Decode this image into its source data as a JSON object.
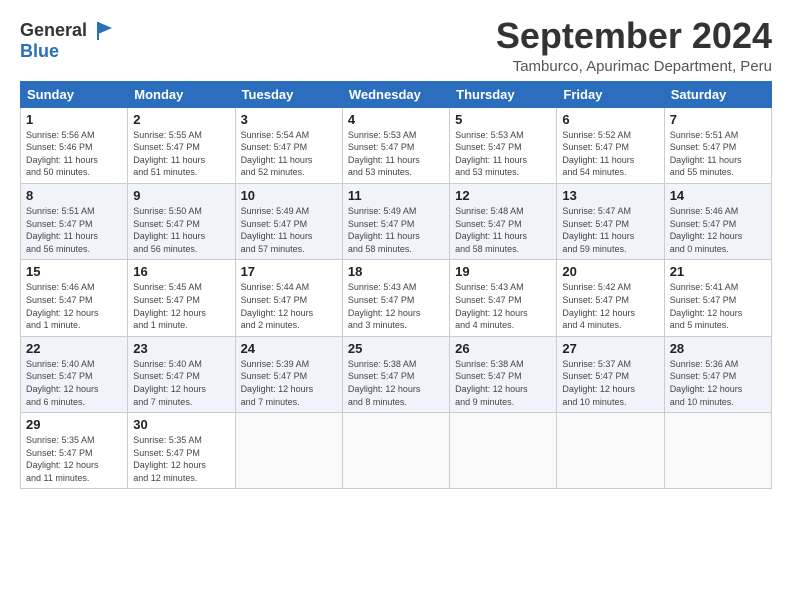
{
  "header": {
    "logo": {
      "line1": "General",
      "line2": "Blue"
    },
    "title": "September 2024",
    "subtitle": "Tamburco, Apurimac Department, Peru"
  },
  "weekdays": [
    "Sunday",
    "Monday",
    "Tuesday",
    "Wednesday",
    "Thursday",
    "Friday",
    "Saturday"
  ],
  "weeks": [
    [
      {
        "day": "1",
        "info": "Sunrise: 5:56 AM\nSunset: 5:46 PM\nDaylight: 11 hours\nand 50 minutes."
      },
      {
        "day": "2",
        "info": "Sunrise: 5:55 AM\nSunset: 5:47 PM\nDaylight: 11 hours\nand 51 minutes."
      },
      {
        "day": "3",
        "info": "Sunrise: 5:54 AM\nSunset: 5:47 PM\nDaylight: 11 hours\nand 52 minutes."
      },
      {
        "day": "4",
        "info": "Sunrise: 5:53 AM\nSunset: 5:47 PM\nDaylight: 11 hours\nand 53 minutes."
      },
      {
        "day": "5",
        "info": "Sunrise: 5:53 AM\nSunset: 5:47 PM\nDaylight: 11 hours\nand 53 minutes."
      },
      {
        "day": "6",
        "info": "Sunrise: 5:52 AM\nSunset: 5:47 PM\nDaylight: 11 hours\nand 54 minutes."
      },
      {
        "day": "7",
        "info": "Sunrise: 5:51 AM\nSunset: 5:47 PM\nDaylight: 11 hours\nand 55 minutes."
      }
    ],
    [
      {
        "day": "8",
        "info": "Sunrise: 5:51 AM\nSunset: 5:47 PM\nDaylight: 11 hours\nand 56 minutes."
      },
      {
        "day": "9",
        "info": "Sunrise: 5:50 AM\nSunset: 5:47 PM\nDaylight: 11 hours\nand 56 minutes."
      },
      {
        "day": "10",
        "info": "Sunrise: 5:49 AM\nSunset: 5:47 PM\nDaylight: 11 hours\nand 57 minutes."
      },
      {
        "day": "11",
        "info": "Sunrise: 5:49 AM\nSunset: 5:47 PM\nDaylight: 11 hours\nand 58 minutes."
      },
      {
        "day": "12",
        "info": "Sunrise: 5:48 AM\nSunset: 5:47 PM\nDaylight: 11 hours\nand 58 minutes."
      },
      {
        "day": "13",
        "info": "Sunrise: 5:47 AM\nSunset: 5:47 PM\nDaylight: 11 hours\nand 59 minutes."
      },
      {
        "day": "14",
        "info": "Sunrise: 5:46 AM\nSunset: 5:47 PM\nDaylight: 12 hours\nand 0 minutes."
      }
    ],
    [
      {
        "day": "15",
        "info": "Sunrise: 5:46 AM\nSunset: 5:47 PM\nDaylight: 12 hours\nand 1 minute."
      },
      {
        "day": "16",
        "info": "Sunrise: 5:45 AM\nSunset: 5:47 PM\nDaylight: 12 hours\nand 1 minute."
      },
      {
        "day": "17",
        "info": "Sunrise: 5:44 AM\nSunset: 5:47 PM\nDaylight: 12 hours\nand 2 minutes."
      },
      {
        "day": "18",
        "info": "Sunrise: 5:43 AM\nSunset: 5:47 PM\nDaylight: 12 hours\nand 3 minutes."
      },
      {
        "day": "19",
        "info": "Sunrise: 5:43 AM\nSunset: 5:47 PM\nDaylight: 12 hours\nand 4 minutes."
      },
      {
        "day": "20",
        "info": "Sunrise: 5:42 AM\nSunset: 5:47 PM\nDaylight: 12 hours\nand 4 minutes."
      },
      {
        "day": "21",
        "info": "Sunrise: 5:41 AM\nSunset: 5:47 PM\nDaylight: 12 hours\nand 5 minutes."
      }
    ],
    [
      {
        "day": "22",
        "info": "Sunrise: 5:40 AM\nSunset: 5:47 PM\nDaylight: 12 hours\nand 6 minutes."
      },
      {
        "day": "23",
        "info": "Sunrise: 5:40 AM\nSunset: 5:47 PM\nDaylight: 12 hours\nand 7 minutes."
      },
      {
        "day": "24",
        "info": "Sunrise: 5:39 AM\nSunset: 5:47 PM\nDaylight: 12 hours\nand 7 minutes."
      },
      {
        "day": "25",
        "info": "Sunrise: 5:38 AM\nSunset: 5:47 PM\nDaylight: 12 hours\nand 8 minutes."
      },
      {
        "day": "26",
        "info": "Sunrise: 5:38 AM\nSunset: 5:47 PM\nDaylight: 12 hours\nand 9 minutes."
      },
      {
        "day": "27",
        "info": "Sunrise: 5:37 AM\nSunset: 5:47 PM\nDaylight: 12 hours\nand 10 minutes."
      },
      {
        "day": "28",
        "info": "Sunrise: 5:36 AM\nSunset: 5:47 PM\nDaylight: 12 hours\nand 10 minutes."
      }
    ],
    [
      {
        "day": "29",
        "info": "Sunrise: 5:35 AM\nSunset: 5:47 PM\nDaylight: 12 hours\nand 11 minutes."
      },
      {
        "day": "30",
        "info": "Sunrise: 5:35 AM\nSunset: 5:47 PM\nDaylight: 12 hours\nand 12 minutes."
      },
      {
        "day": "",
        "info": ""
      },
      {
        "day": "",
        "info": ""
      },
      {
        "day": "",
        "info": ""
      },
      {
        "day": "",
        "info": ""
      },
      {
        "day": "",
        "info": ""
      }
    ]
  ]
}
